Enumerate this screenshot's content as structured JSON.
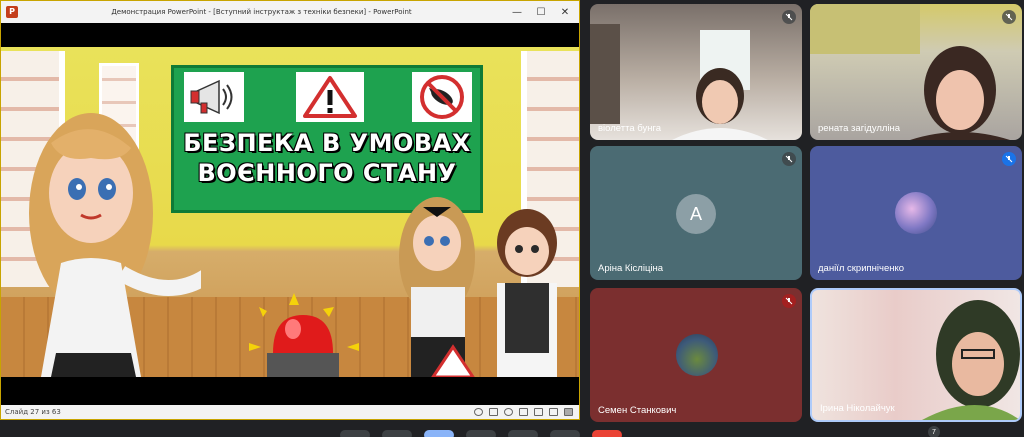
{
  "ppt": {
    "logo": "P",
    "title": "Демонстрация PowerPoint - [Вступний інструктаж з техніки безпеки] - PowerPoint",
    "minimize": "—",
    "maximize": "☐",
    "close": "✕",
    "slide_heading_line1": "БЕЗПЕКА В УМОВАХ",
    "slide_heading_line2": "ВОЄННОГО СТАНУ",
    "slide_counter": "Слайд 27 из 63"
  },
  "participants": [
    {
      "name": "віолетта бунга",
      "mic": "muted"
    },
    {
      "name": "рената загідулліна",
      "mic": "muted"
    },
    {
      "name": "Аріна Кісліціна",
      "initial": "A",
      "mic": "muted"
    },
    {
      "name": "даніїл скрипніченко",
      "mic": "muted"
    },
    {
      "name": "Семен Станкович",
      "mic": "muted"
    },
    {
      "name": "Ірина Ніколайчук",
      "mic": "active"
    }
  ],
  "others_count": "7",
  "icons": {
    "ppt": "powerpoint-icon",
    "megaphone": "megaphone-icon",
    "warning": "warning-icon",
    "no_bomb": "no-bomb-icon",
    "mic_off": "mic-off-icon"
  },
  "colors": {
    "board_green": "#1ea24f",
    "meet_bg": "#202124",
    "active_border": "#aecbfa"
  }
}
